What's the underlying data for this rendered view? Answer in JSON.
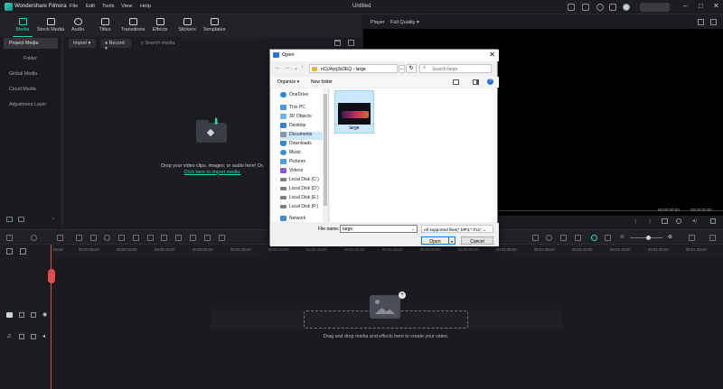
{
  "app": {
    "name": "Wondershare Filmora",
    "doc_title": "Untitled",
    "accent": "#2fd5b5"
  },
  "menu": [
    "File",
    "Edit",
    "Tools",
    "View",
    "Help"
  ],
  "toolbar": {
    "tabs": [
      {
        "label": "Media",
        "icon": "media-icon"
      },
      {
        "label": "Stock Media",
        "icon": "stock-media-icon"
      },
      {
        "label": "Audio",
        "icon": "audio-icon"
      },
      {
        "label": "Titles",
        "icon": "titles-icon"
      },
      {
        "label": "Transitions",
        "icon": "transitions-icon"
      },
      {
        "label": "Effects",
        "icon": "effects-icon"
      },
      {
        "label": "Stickers",
        "icon": "stickers-icon"
      },
      {
        "label": "Templates",
        "icon": "templates-icon"
      }
    ]
  },
  "sidebar": {
    "items": [
      "Project Media",
      "Folder",
      "Global Media",
      "Cloud Media",
      "Adjustment Layer"
    ]
  },
  "media": {
    "import_label": "Import",
    "record_label": "Record",
    "search_placeholder": "Search media",
    "drop_text": "Drop your video clips, images, or audio here! Or,",
    "drop_link": "Click here to import media."
  },
  "player": {
    "tab": "Player",
    "quality": "Full Quality",
    "time_current": "00:00:00:00",
    "time_total": "00:00:00:00"
  },
  "timeline": {
    "ticks": [
      "00:00",
      "00:00:05:00",
      "00:00:10:00",
      "00:00:15:00",
      "00:00:20:00",
      "00:00:25:00",
      "00:00:30:00",
      "00:00:35:00",
      "00:00:40:00",
      "00:00:45:00",
      "00:00:50:00",
      "00:00:55:00",
      "00:01:00:00",
      "00:01:05:00",
      "00:01:10:00",
      "00:01:15:00",
      "00:01:20:00",
      "00:01:25:00"
    ],
    "drop_text": "Drag and drop media and effects here to create your video."
  },
  "dialog": {
    "title": "Open",
    "path": [
      "nCU4yq3sDEQ",
      "large"
    ],
    "search_placeholder": "Search large",
    "organize": "Organize",
    "new_folder": "New folder",
    "tree": [
      "OneDrive",
      "This PC",
      "3D Objects",
      "Desktop",
      "Documents",
      "Downloads",
      "Music",
      "Pictures",
      "Videos",
      "Local Disk (C:)",
      "Local Disk (D:)",
      "Local Disk (E:)",
      "Local Disk (F:)",
      "Network"
    ],
    "selected_tree_item": "Documents",
    "files": [
      {
        "name": "large"
      }
    ],
    "file_name_label": "File name:",
    "file_name_value": "large",
    "file_type": "All supported files(*.MP4;*.FLV;",
    "open_label": "Open",
    "cancel_label": "Cancel"
  }
}
